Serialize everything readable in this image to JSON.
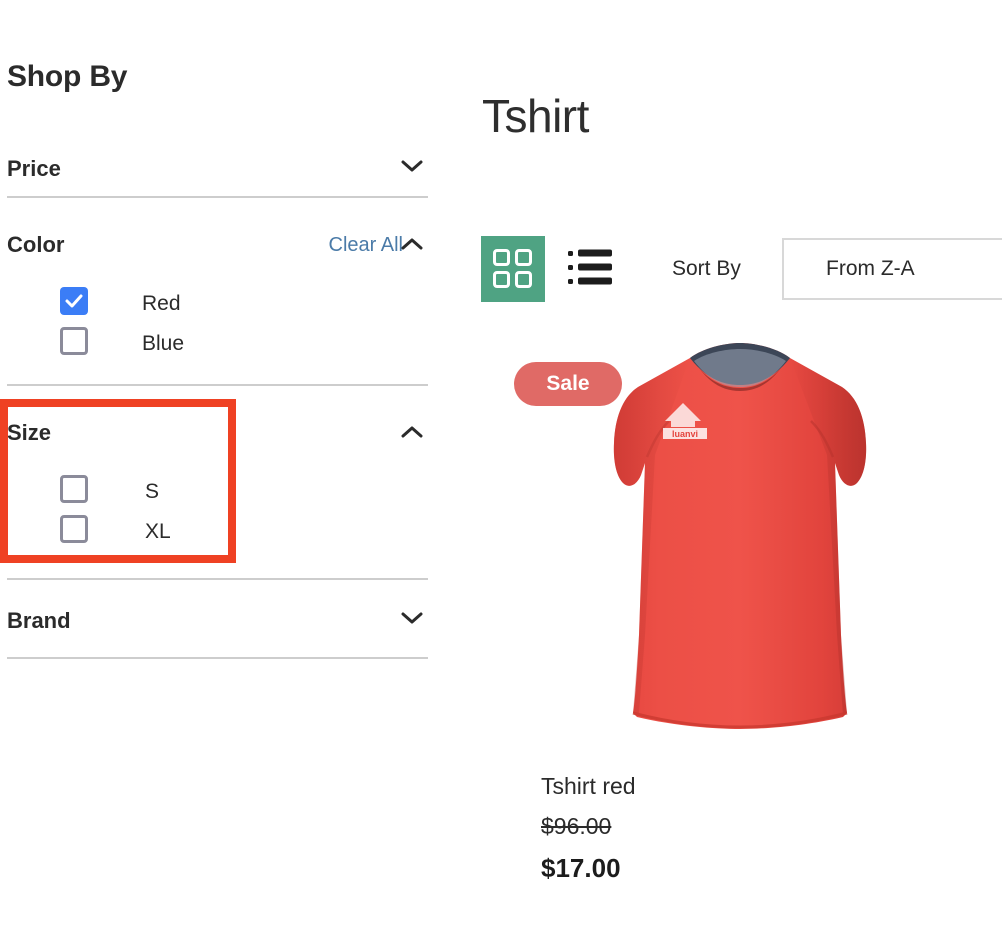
{
  "sidebar": {
    "heading": "Shop By",
    "filters": [
      {
        "label": "Price",
        "chevron": "chevron-down-icon",
        "expanded": false,
        "clear_all": null,
        "options": []
      },
      {
        "label": "Color",
        "chevron": "chevron-up-icon",
        "expanded": true,
        "clear_all": "Clear All",
        "options": [
          {
            "label": "Red",
            "checked": true
          },
          {
            "label": "Blue",
            "checked": false
          }
        ]
      },
      {
        "label": "Size",
        "chevron": "chevron-up-icon",
        "expanded": true,
        "clear_all": null,
        "highlighted": true,
        "options": [
          {
            "label": "S",
            "checked": false
          },
          {
            "label": "XL",
            "checked": false
          }
        ]
      },
      {
        "label": "Brand",
        "chevron": "chevron-down-icon",
        "expanded": false,
        "clear_all": null,
        "options": []
      }
    ]
  },
  "main": {
    "page_title": "Tshirt",
    "toolbar": {
      "grid_view_icon": "grid-view-icon",
      "grid_view_active": true,
      "list_view_icon": "list-view-icon",
      "list_view_active": false,
      "sort_label": "Sort By",
      "sort_value": "From Z-A"
    },
    "products": [
      {
        "badge": "Sale",
        "name": "Tshirt red",
        "old_price": "$96.00",
        "price": "$17.00",
        "image_alt": "red sleeveless tshirt with luanvi logo",
        "brand_mark": "luanvi"
      }
    ]
  },
  "colors": {
    "accent_green": "#4fa383",
    "checkbox_blue": "#3b7df6",
    "link_blue": "#4b7ba8",
    "sale_badge": "#e06a66",
    "highlight_box": "#ef4123",
    "shirt_red": "#e8443c",
    "divider": "#cdcdcd"
  }
}
